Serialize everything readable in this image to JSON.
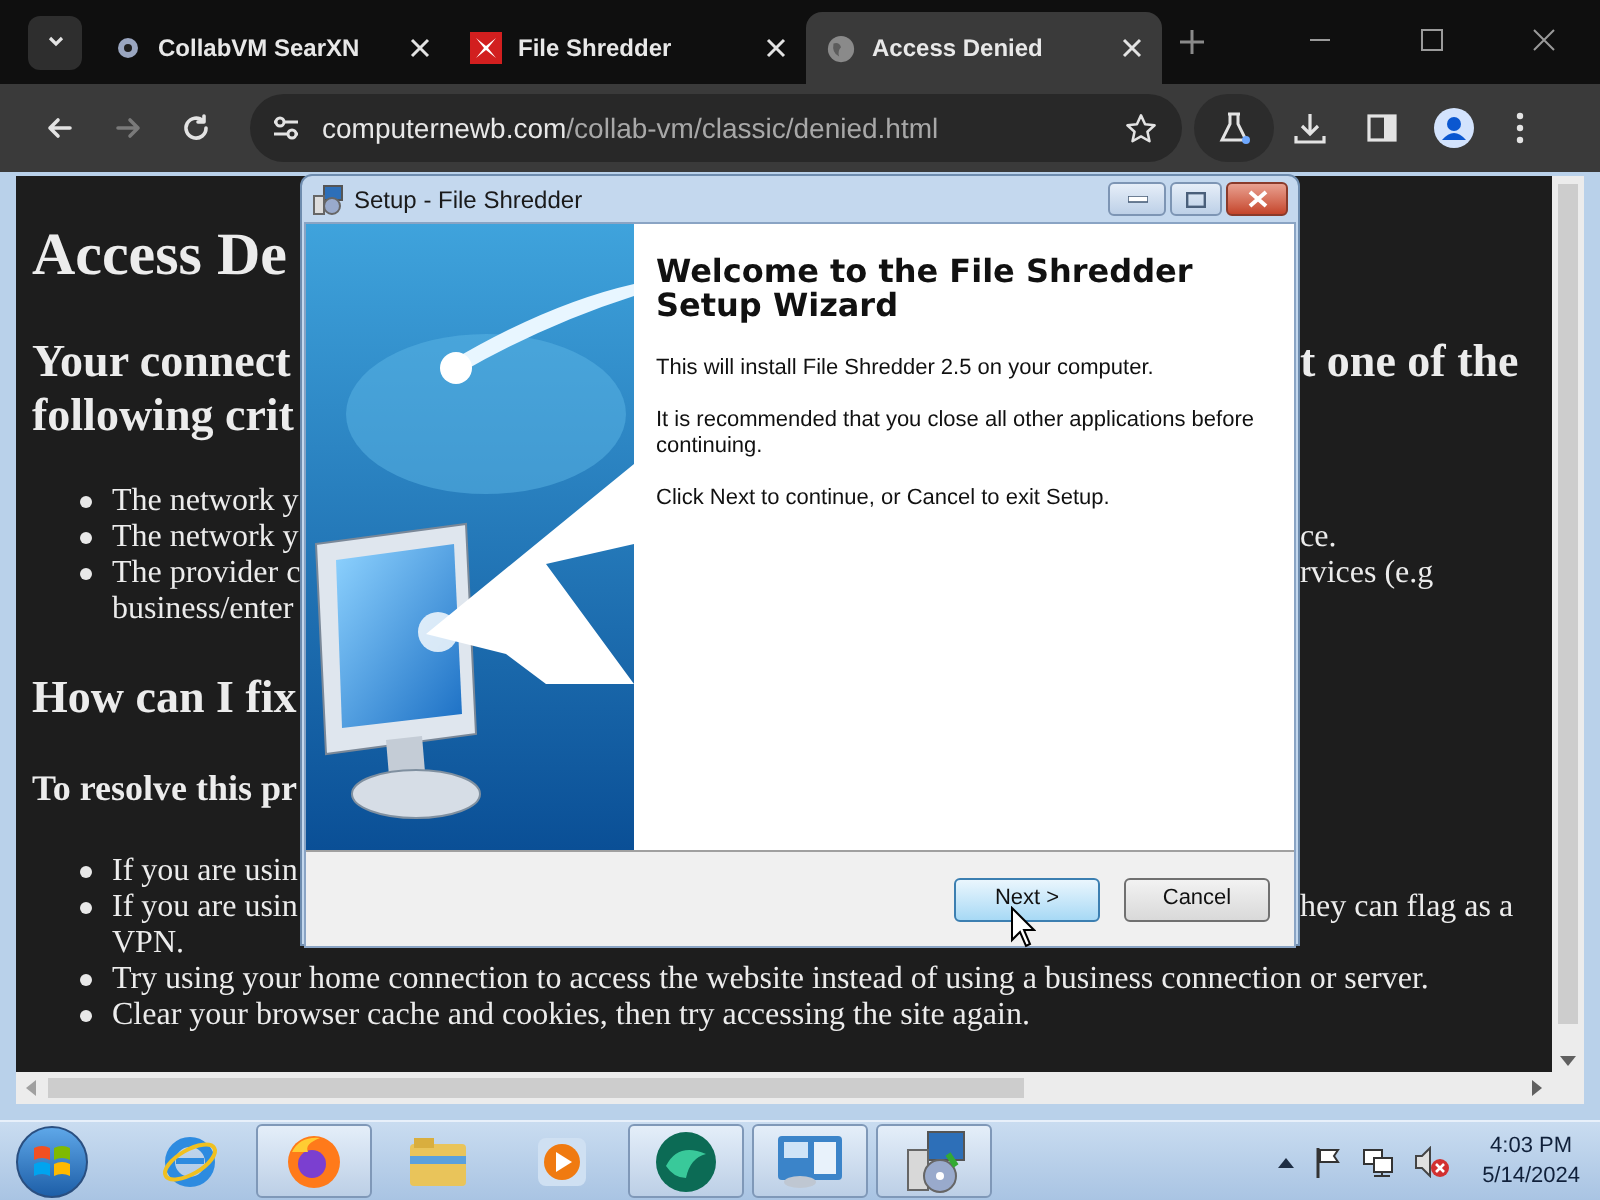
{
  "browser": {
    "tabs": [
      {
        "kind": "search",
        "title": "CollabVM SearXN",
        "selected": false
      },
      {
        "kind": "shredder",
        "title": "File Shredder",
        "selected": false
      },
      {
        "kind": "globe",
        "title": "Access Denied",
        "selected": true
      }
    ],
    "nav_buttons": [
      {
        "kind": "back",
        "disabled": false
      },
      {
        "kind": "forward",
        "disabled": true
      },
      {
        "kind": "reload",
        "disabled": false
      }
    ],
    "address": {
      "host": "computernewb.com",
      "path": "/collab-vm/classic/denied.html"
    }
  },
  "page": {
    "blocks": [
      {
        "kind": "h1",
        "left": "Access De"
      },
      {
        "kind": "h2",
        "left": "Your connect",
        "right": "t one of the"
      },
      {
        "kind": "h2_cont",
        "left": "following crit"
      },
      {
        "kind": "bullet_first",
        "left": "The network y"
      },
      {
        "kind": "bullet",
        "left": "The network y",
        "right": "ce."
      },
      {
        "kind": "bullet",
        "left": "The provider c",
        "right": "rvices (e.g"
      },
      {
        "kind": "bullet_cont",
        "left": "business/enter"
      },
      {
        "kind": "h2",
        "left": "How can I fix"
      },
      {
        "kind": "h3",
        "left": "To resolve this pr"
      },
      {
        "kind": "bullet_first",
        "left": "If you are usin"
      },
      {
        "kind": "bullet",
        "left": "If you are usin",
        "right": "hey can flag as a"
      },
      {
        "kind": "bullet_cont",
        "left": "VPN."
      },
      {
        "kind": "bullet",
        "left": "Try using your home connection to access the website instead of using a business connection or server."
      },
      {
        "kind": "bullet",
        "left": "Clear your browser cache and cookies, then try accessing the site again."
      }
    ]
  },
  "dialog": {
    "title": "Setup - File Shredder",
    "heading": "Welcome to the File Shredder Setup Wizard",
    "paragraphs": [
      "This will install File Shredder 2.5 on your computer.",
      "It is recommended that you close all other applications before continuing.",
      "Click Next to continue, or Cancel to exit Setup."
    ],
    "buttons": [
      {
        "label": "Next >",
        "default": true
      },
      {
        "label": "Cancel",
        "default": false
      }
    ]
  },
  "taskbar": {
    "apps": [
      {
        "kind": "ie",
        "open": false
      },
      {
        "kind": "firefox",
        "open": true
      },
      {
        "kind": "explorer",
        "open": false
      },
      {
        "kind": "media",
        "open": false
      },
      {
        "kind": "green",
        "open": true
      },
      {
        "kind": "control",
        "open": true
      },
      {
        "kind": "installer",
        "open": true
      }
    ],
    "time": "4:03 PM",
    "date": "5/14/2024"
  }
}
